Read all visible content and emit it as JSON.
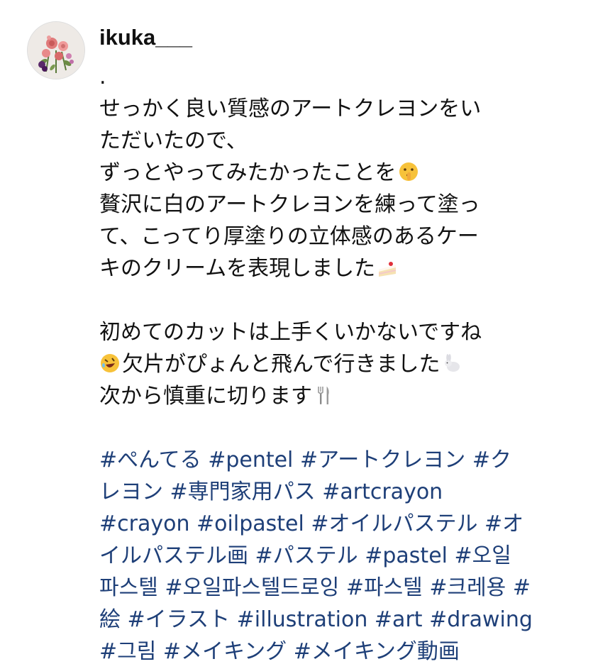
{
  "post": {
    "username": "ikuka___",
    "caption_lines": [
      ".",
      "せっかく良い質感のアートクレヨンをい",
      "ただいたので、",
      "ずっとやってみたかったことを",
      "贅沢に白のアートクレヨンを練って塗っ",
      "て、こってり厚塗りの立体感のあるケー",
      "キのクリームを表現しました",
      "",
      "初めてのカットは上手くいかないですね",
      "欠片がぴょんと飛んで行きました",
      "次から慎重に切ります"
    ],
    "emojis": {
      "shushing": "shushing-face-emoji",
      "cake": "shortcake-emoji",
      "laughing": "rolling-on-floor-laughing-emoji",
      "rabbit": "rabbit-emoji",
      "fork": "fork-and-knife-emoji"
    },
    "hashtag_lines": [
      [
        "#ぺんてる",
        "#pentel",
        "#アートクレヨン",
        "#ク"
      ],
      [
        "レヨン",
        "#専門家用パス",
        "#artcrayon"
      ],
      [
        "#crayon",
        "#oilpastel",
        "#オイルパステル",
        "#オ"
      ],
      [
        "イルパステル画",
        "#パステル",
        "#pastel",
        "#오일"
      ],
      [
        "파스텔",
        "#오일파스텔드로잉",
        "#파스텔",
        "#크레용",
        "#"
      ],
      [
        "絵",
        "#イラスト",
        "#illustration",
        "#art",
        "#drawing"
      ],
      [
        "#그림",
        "#メイキング",
        "#メイキング動画"
      ]
    ],
    "colors": {
      "text": "#111111",
      "hashtag": "#1e3f78",
      "background": "#ffffff"
    }
  }
}
